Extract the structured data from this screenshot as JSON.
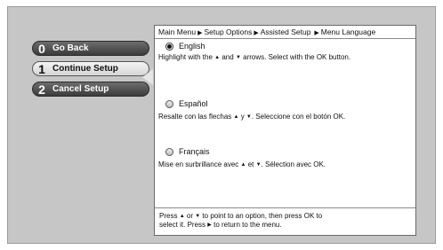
{
  "menu": {
    "items": [
      {
        "num": "0",
        "label": "Go Back"
      },
      {
        "num": "1",
        "label": "Continue Setup"
      },
      {
        "num": "2",
        "label": "Cancel Setup"
      }
    ]
  },
  "breadcrumb": [
    "Main Menu",
    "Setup Options",
    "Assisted Setup",
    "Menu Language"
  ],
  "options": [
    {
      "name": "English",
      "selected": true,
      "desc_pre": "Highlight with the",
      "desc_mid": "and",
      "desc_post": "arrows. Select with the OK button."
    },
    {
      "name": "Español",
      "selected": false,
      "desc_pre": "Resalte con las flechas",
      "desc_mid": "y",
      "desc_post": ". Seleccione con el botón OK."
    },
    {
      "name": "Français",
      "selected": false,
      "desc_pre": "Mise en surbrillance avec",
      "desc_mid": "et",
      "desc_post": ". Sélection avec OK."
    }
  ],
  "footer": {
    "part1": "Press",
    "part2": "or",
    "part3": "to point to an option, then press OK to",
    "part4": "select it. Press",
    "part5": "to return to the menu."
  },
  "icons": {
    "up": "up-arrow-icon",
    "down": "down-arrow-icon",
    "right": "right-arrow-icon"
  }
}
